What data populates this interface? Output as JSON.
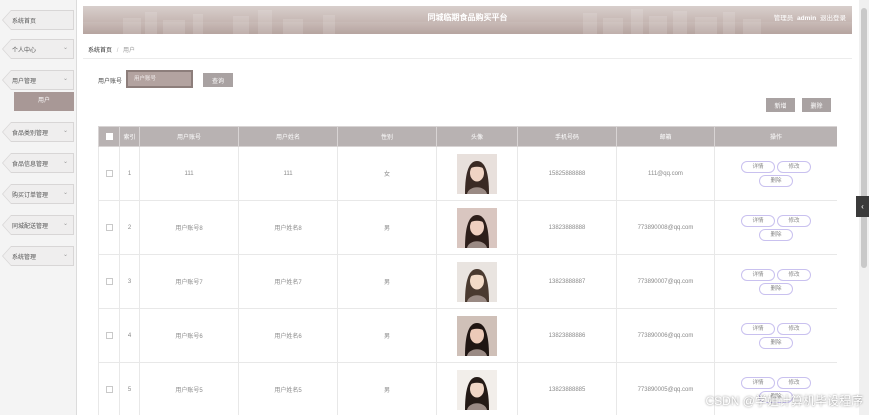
{
  "sidebar": {
    "items": [
      {
        "label": "系统首页",
        "has_chevron": false
      },
      {
        "label": "个人中心",
        "has_chevron": true
      },
      {
        "label": "用户管理",
        "has_chevron": true
      },
      {
        "label": "食品类别管理",
        "has_chevron": true
      },
      {
        "label": "食品信息管理",
        "has_chevron": true
      },
      {
        "label": "购买订单管理",
        "has_chevron": true
      },
      {
        "label": "同城配送管理",
        "has_chevron": true
      },
      {
        "label": "系统管理",
        "has_chevron": true
      }
    ],
    "active_sub": "用户",
    "chevron_icon": "chevron-down-icon"
  },
  "header": {
    "title": "同城临期食品购买平台",
    "role": "管理员",
    "username": "admin",
    "logout": "退出登录"
  },
  "breadcrumb": {
    "home": "系统首页",
    "current": "用户"
  },
  "search": {
    "label": "用户账号",
    "placeholder": "用户账号",
    "button": "查询"
  },
  "actions": {
    "add": "新增",
    "delete": "删除"
  },
  "table": {
    "headers": [
      "索引",
      "用户账号",
      "用户姓名",
      "性别",
      "头像",
      "手机号码",
      "邮箱",
      "操作"
    ],
    "rows": [
      {
        "index": "1",
        "account": "111",
        "name": "111",
        "gender": "女",
        "phone": "15825888888",
        "email": "111@qq.com",
        "avatar": "avatar-photo-1"
      },
      {
        "index": "2",
        "account": "用户账号8",
        "name": "用户姓名8",
        "gender": "男",
        "phone": "13823888888",
        "email": "773890008@qq.com",
        "avatar": "avatar-photo-2"
      },
      {
        "index": "3",
        "account": "用户账号7",
        "name": "用户姓名7",
        "gender": "男",
        "phone": "13823888887",
        "email": "773890007@qq.com",
        "avatar": "avatar-photo-3"
      },
      {
        "index": "4",
        "account": "用户账号6",
        "name": "用户姓名6",
        "gender": "男",
        "phone": "13823888886",
        "email": "773890006@qq.com",
        "avatar": "avatar-photo-4"
      },
      {
        "index": "5",
        "account": "用户账号5",
        "name": "用户姓名5",
        "gender": "男",
        "phone": "13823888885",
        "email": "773890005@qq.com",
        "avatar": "avatar-photo-5"
      }
    ],
    "row_buttons": {
      "detail": "详情",
      "edit": "修改",
      "delete": "删除"
    }
  },
  "watermark": "CSDN @学姐计算机毕设程序",
  "toggle_icon": "chevron-left-icon",
  "colors": {
    "header": "#c6b7b3",
    "active_submenu": "#a89896",
    "table_header": "#b8b2b2",
    "button": "#a9a2a2",
    "op_border": "#c9c1ef"
  }
}
